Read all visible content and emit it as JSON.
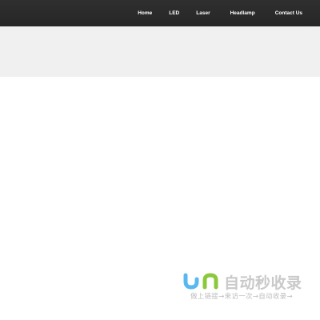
{
  "nav": {
    "items": [
      "Home",
      "LED",
      "Laser",
      "Headlamp",
      "Contact Us"
    ]
  },
  "watermark": {
    "brand": "自动秒收录",
    "tagline": "做上链接→来访一次→自动收录→"
  },
  "colors": {
    "topbar": "#2b2b2b",
    "banner": "#f0f0f0",
    "logo_blue": "#5ab8f0",
    "logo_green": "#8cc83c"
  }
}
